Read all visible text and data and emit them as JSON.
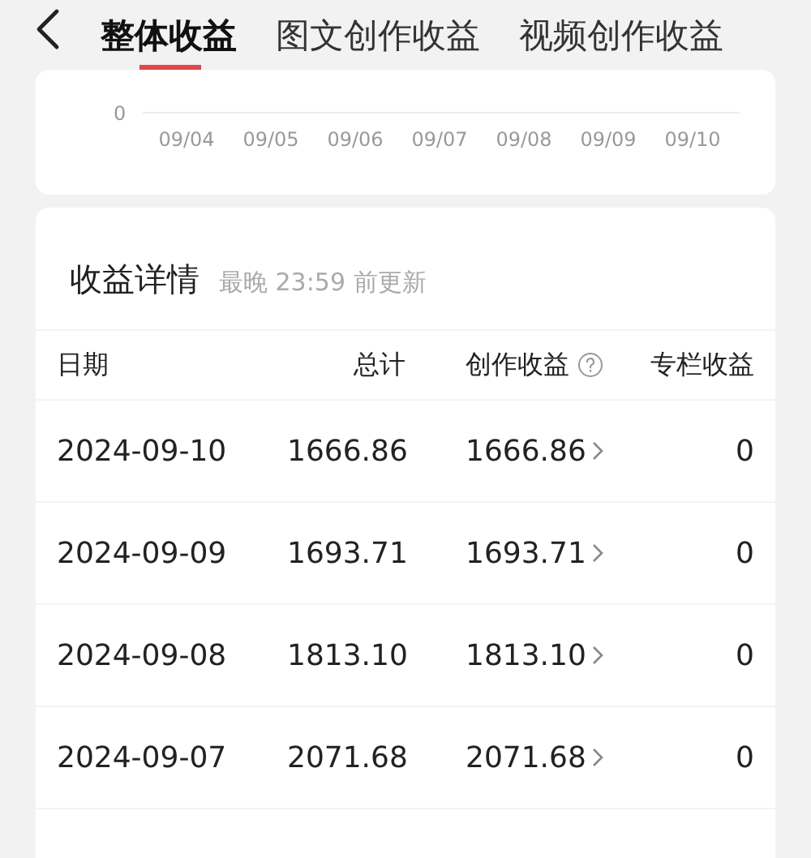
{
  "tabs": [
    {
      "label": "整体收益",
      "selected": true
    },
    {
      "label": "图文创作收益",
      "selected": false
    },
    {
      "label": "视频创作收益",
      "selected": false
    }
  ],
  "chart": {
    "y_tick": "0",
    "x_labels": [
      "09/04",
      "09/05",
      "09/06",
      "09/07",
      "09/08",
      "09/09",
      "09/10"
    ]
  },
  "details": {
    "title": "收益详情",
    "update_note": "最晚 23:59 前更新",
    "columns": [
      "日期",
      "总计",
      "创作收益",
      "专栏收益"
    ],
    "rows": [
      {
        "date": "2024-09-10",
        "total": "1666.86",
        "creation": "1666.86",
        "column": "0"
      },
      {
        "date": "2024-09-09",
        "total": "1693.71",
        "creation": "1693.71",
        "column": "0"
      },
      {
        "date": "2024-09-08",
        "total": "1813.10",
        "creation": "1813.10",
        "column": "0"
      },
      {
        "date": "2024-09-07",
        "total": "2071.68",
        "creation": "2071.68",
        "column": "0"
      }
    ]
  }
}
